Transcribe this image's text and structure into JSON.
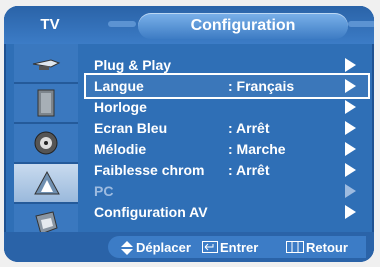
{
  "header": {
    "tv_label": "TV",
    "title": "Configuration"
  },
  "sidebar": {
    "items": [
      {
        "icon": "antenna-icon"
      },
      {
        "icon": "speaker-icon"
      },
      {
        "icon": "vcr-icon"
      },
      {
        "icon": "settings-icon"
      },
      {
        "icon": "input-icon"
      }
    ]
  },
  "menu": {
    "items": [
      {
        "label": "Plug & Play",
        "value": ""
      },
      {
        "label": "Langue",
        "value": ": Français"
      },
      {
        "label": "Horloge",
        "value": ""
      },
      {
        "label": "Ecran Bleu",
        "value": ": Arrêt"
      },
      {
        "label": "Mélodie",
        "value": ": Marche"
      },
      {
        "label": "Faiblesse chrom",
        "value": ": Arrêt"
      },
      {
        "label": "PC",
        "value": ""
      },
      {
        "label": "Configuration AV",
        "value": ""
      }
    ]
  },
  "footer": {
    "move": "Déplacer",
    "enter": "Entrer",
    "back": "Retour"
  },
  "colors": {
    "panel": "#2f6fb6",
    "highlight": "#ffffff"
  }
}
